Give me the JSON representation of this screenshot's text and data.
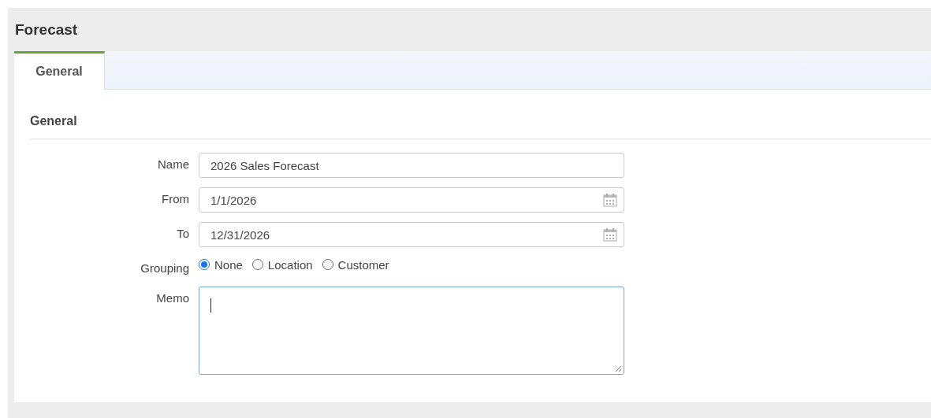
{
  "title": "Forecast",
  "tabs": [
    {
      "label": "General",
      "selected": true
    }
  ],
  "section": {
    "title": "General"
  },
  "fields": [
    {
      "kind": "text",
      "label": "Name",
      "value": "2026 Sales Forecast"
    },
    {
      "kind": "date",
      "label": "From",
      "value": "1/1/2026"
    },
    {
      "kind": "date",
      "label": "To",
      "value": "12/31/2026"
    },
    {
      "kind": "radio",
      "label": "Grouping",
      "options": [
        {
          "label": "None",
          "selected": true
        },
        {
          "label": "Location",
          "selected": false
        },
        {
          "label": "Customer",
          "selected": false
        }
      ]
    },
    {
      "kind": "memo",
      "label": "Memo",
      "focused": true
    }
  ]
}
